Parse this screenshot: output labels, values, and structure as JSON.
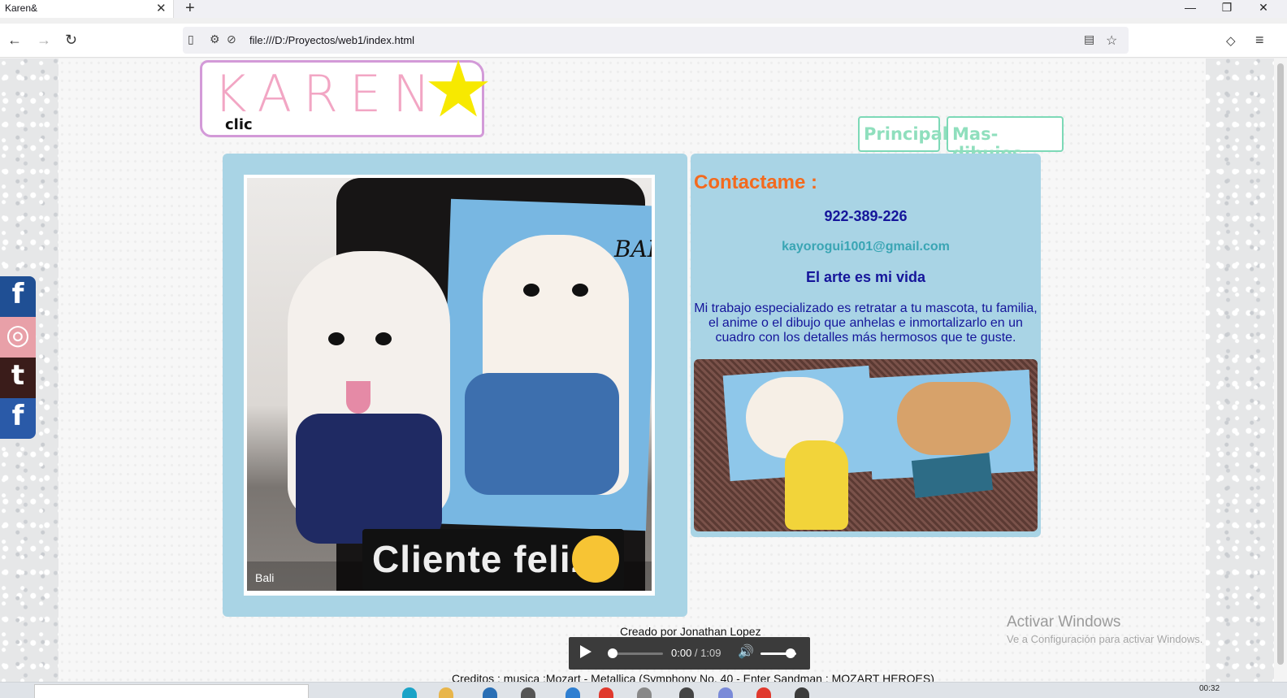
{
  "browser": {
    "tab_title": "Karen&",
    "tab_close": "✕",
    "new_tab": "+",
    "url": "file:///D:/Proyectos/web1/index.html",
    "window_controls": {
      "minimize": "—",
      "restore": "❐",
      "close": "✕"
    }
  },
  "logo": {
    "text": "KAREN",
    "star": "★",
    "subtext": "clic"
  },
  "nav": {
    "principal": "Principal",
    "mas_dibujos": "Mas-dibujos"
  },
  "photo": {
    "badge": "Cliente feliz",
    "caption": "Bali",
    "painting_label": "BALI"
  },
  "contact": {
    "title": "Contactame :",
    "phone": "922-389-226",
    "email": "kayorogui1001@gmail.com",
    "motto": "El arte es mi vida",
    "description": "Mi trabajo especializado es retratar a tu mascota, tu familia, el anime o el dibujo que anhelas e inmortalizarlo en un cuadro con los detalles más hermosos que te guste."
  },
  "social": [
    {
      "name": "facebook",
      "glyph": "f",
      "color": "#1f4f94"
    },
    {
      "name": "instagram",
      "glyph": "◎",
      "color": "#e8a0a8"
    },
    {
      "name": "tumblr",
      "glyph": "t",
      "color": "#3a1c1a"
    },
    {
      "name": "facebook-square",
      "glyph": "f",
      "color": "#2a5aa8"
    }
  ],
  "footer": {
    "credit": "Creado por Jonathan Lopez",
    "credits_line": "Creditos : musica :Mozart - Metallica (Symphony No. 40 - Enter Sandman : MOZART HEROES)"
  },
  "audio": {
    "current": "0:00",
    "separator": " / ",
    "duration": "1:09",
    "progress": 0,
    "volume": 0.85
  },
  "watermark": {
    "title": "Activar Windows",
    "subtitle": "Ve a Configuración para activar Windows."
  },
  "taskbar": {
    "clock": "00:32"
  },
  "colors": {
    "panel": "#a9d4e5",
    "accent_orange": "#f36a1e",
    "navy": "#15159a",
    "teal": "#3aa5b4",
    "nav_green": "#7dd9b7"
  }
}
